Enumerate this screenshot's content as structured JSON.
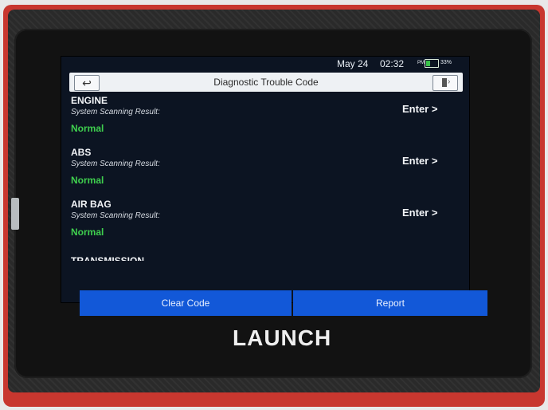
{
  "status_bar": {
    "date": "May 24",
    "time": "02:32",
    "ampm": "PM",
    "battery_percent": "33%",
    "battery_level": 0.33
  },
  "header": {
    "title": "Diagnostic Trouble Code",
    "back_icon": "back-arrow-icon",
    "exit_icon": "exit-door-icon"
  },
  "systems": [
    {
      "name": "ENGINE",
      "label": "System Scanning Result:",
      "status": "Normal",
      "action": "Enter >"
    },
    {
      "name": "ABS",
      "label": "System Scanning Result:",
      "status": "Normal",
      "action": "Enter >"
    },
    {
      "name": "AIR BAG",
      "label": "System Scanning Result:",
      "status": "Normal",
      "action": "Enter >"
    }
  ],
  "partial_next_system": "TRANSMISSION",
  "buttons": {
    "clear_code": "Clear Code",
    "report": "Report"
  },
  "device": {
    "brand": "LAUNCH"
  },
  "colors": {
    "accent_blue": "#1258d8",
    "status_green": "#3fcf4e",
    "device_red": "#c8372f"
  }
}
